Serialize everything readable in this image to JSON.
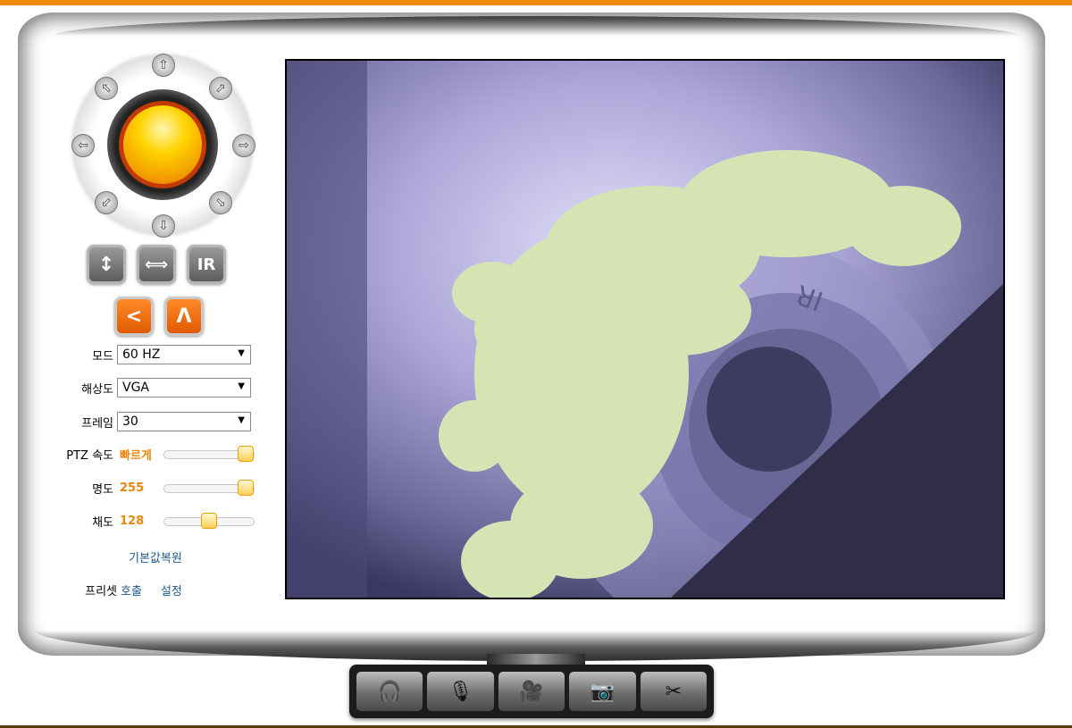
{
  "colors": {
    "accent": "#f28a00",
    "slider_value": "#e8860d",
    "link": "#1e5a8c"
  },
  "ptz": {
    "arrows": [
      "up",
      "down",
      "left",
      "right",
      "up-left",
      "up-right",
      "down-left",
      "down-right"
    ],
    "glyphs": {
      "up": "⇧",
      "down": "⇩",
      "left": "⇦",
      "right": "⇨",
      "ul": "⬁",
      "ur": "⬀",
      "dl": "⬃",
      "dr": "⬂"
    }
  },
  "buttons": {
    "flip_icon": "↕",
    "mirror_icon": "⟺",
    "ir_label": "IR",
    "left_icon": "<",
    "up_icon": "Λ"
  },
  "settings": {
    "mode": {
      "label": "모드",
      "value": "60 HZ"
    },
    "resolution": {
      "label": "해상도",
      "value": "VGA"
    },
    "frame": {
      "label": "프레임",
      "value": "30"
    },
    "ptz_speed": {
      "label": "PTZ 속도",
      "value": "빠르게",
      "level": 1.0
    },
    "brightness": {
      "label": "명도",
      "value": "255",
      "level": 1.0
    },
    "saturation": {
      "label": "채도",
      "value": "128",
      "level": 0.5
    },
    "caret": "▼"
  },
  "links": {
    "reset_defaults": "기본값복원",
    "preset_label": "프리셋",
    "preset_call": "호출",
    "preset_set": "설정"
  },
  "video": {
    "imprint_ir": "IR"
  },
  "toolbar": {
    "icons": [
      "headphones-icon",
      "microphone-icon",
      "video-camera-icon",
      "camera-icon",
      "tools-icon"
    ],
    "glyphs": [
      "🎧",
      "🎙",
      "🎥",
      "📷",
      "✂"
    ]
  }
}
